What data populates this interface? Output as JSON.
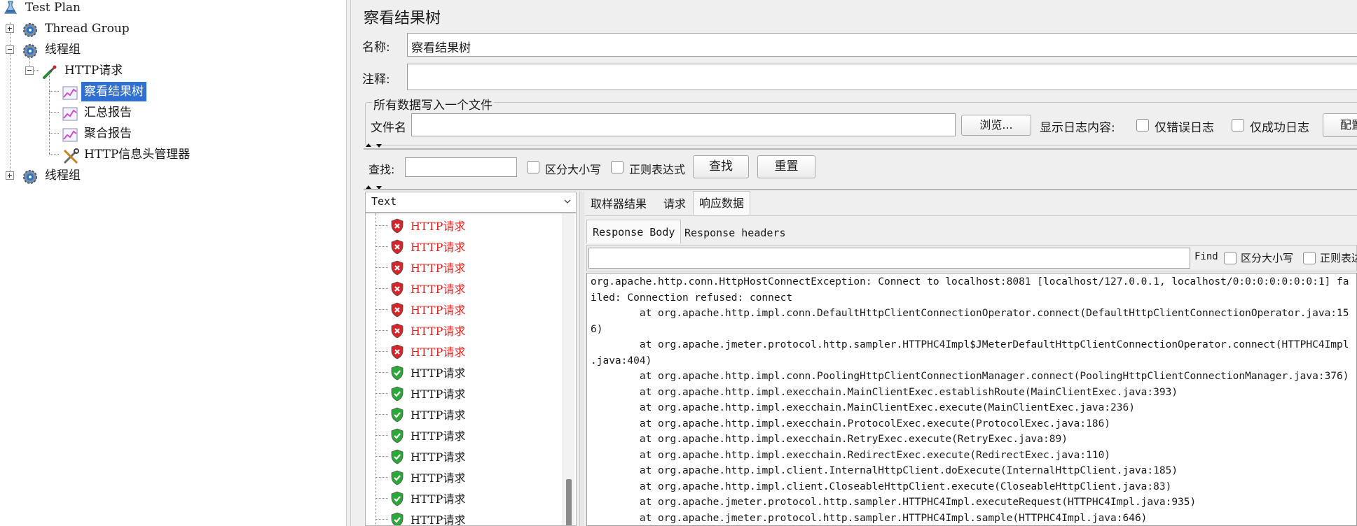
{
  "tree": {
    "items": [
      {
        "label": "Test Plan"
      },
      {
        "label": "Thread Group"
      },
      {
        "label": "线程组"
      },
      {
        "label": "HTTP请求"
      },
      {
        "label": "察看结果树"
      },
      {
        "label": "汇总报告"
      },
      {
        "label": "聚合报告"
      },
      {
        "label": "HTTP信息头管理器"
      },
      {
        "label": "线程组"
      }
    ]
  },
  "panel": {
    "title": "察看结果树",
    "name_label": "名称:",
    "name_value": "察看结果树",
    "comment_label": "注释:",
    "comment_value": "",
    "file_group_title": "所有数据写入一个文件",
    "filename_label": "文件名",
    "filename_value": "",
    "browse_button": "浏览...",
    "log_display_label": "显示日志内容:",
    "errors_only_label": "仅错误日志",
    "success_only_label": "仅成功日志",
    "config_button": "配置"
  },
  "search": {
    "label": "查找:",
    "value": "",
    "case_sensitive_label": "区分大小写",
    "regex_label": "正则表达式",
    "find_button": "查找",
    "reset_button": "重置"
  },
  "results": {
    "renderer": "Text",
    "items": [
      {
        "label": "HTTP请求",
        "status": "error"
      },
      {
        "label": "HTTP请求",
        "status": "error"
      },
      {
        "label": "HTTP请求",
        "status": "error"
      },
      {
        "label": "HTTP请求",
        "status": "error"
      },
      {
        "label": "HTTP请求",
        "status": "error"
      },
      {
        "label": "HTTP请求",
        "status": "error"
      },
      {
        "label": "HTTP请求",
        "status": "error"
      },
      {
        "label": "HTTP请求",
        "status": "success"
      },
      {
        "label": "HTTP请求",
        "status": "success"
      },
      {
        "label": "HTTP请求",
        "status": "success"
      },
      {
        "label": "HTTP请求",
        "status": "success"
      },
      {
        "label": "HTTP请求",
        "status": "success"
      },
      {
        "label": "HTTP请求",
        "status": "success"
      },
      {
        "label": "HTTP请求",
        "status": "success"
      },
      {
        "label": "HTTP请求",
        "status": "success"
      }
    ]
  },
  "tabs": {
    "main": [
      "取样器结果",
      "请求",
      "响应数据"
    ],
    "sub": [
      "Response Body",
      "Response headers"
    ]
  },
  "response": {
    "find_label": "Find",
    "find_value": "",
    "case_sensitive_label": "区分大小写",
    "regex_label": "正则表达",
    "lines": [
      "org.apache.http.conn.HttpHostConnectException: Connect to localhost:8081 [localhost/127.0.0.1, localhost/0:0:0:0:0:0:0:1] fa",
      "iled: Connection refused: connect",
      "\tat org.apache.http.impl.conn.DefaultHttpClientConnectionOperator.connect(DefaultHttpClientConnectionOperator.java:15",
      "6)",
      "\tat org.apache.jmeter.protocol.http.sampler.HTTPHC4Impl$JMeterDefaultHttpClientConnectionOperator.connect(HTTPHC4Impl",
      ".java:404)",
      "\tat org.apache.http.impl.conn.PoolingHttpClientConnectionManager.connect(PoolingHttpClientConnectionManager.java:376)",
      "\tat org.apache.http.impl.execchain.MainClientExec.establishRoute(MainClientExec.java:393)",
      "\tat org.apache.http.impl.execchain.MainClientExec.execute(MainClientExec.java:236)",
      "\tat org.apache.http.impl.execchain.ProtocolExec.execute(ProtocolExec.java:186)",
      "\tat org.apache.http.impl.execchain.RetryExec.execute(RetryExec.java:89)",
      "\tat org.apache.http.impl.execchain.RedirectExec.execute(RedirectExec.java:110)",
      "\tat org.apache.http.impl.client.InternalHttpClient.doExecute(InternalHttpClient.java:185)",
      "\tat org.apache.http.impl.client.CloseableHttpClient.execute(CloseableHttpClient.java:83)",
      "\tat org.apache.jmeter.protocol.http.sampler.HTTPHC4Impl.executeRequest(HTTPHC4Impl.java:935)",
      "\tat org.apache.jmeter.protocol.http.sampler.HTTPHC4Impl.sample(HTTPHC4Impl.java:646)"
    ]
  },
  "colors": {
    "selection": "#2f6fd1",
    "error_text": "#e8231f",
    "error_icon": "#d4262a",
    "success_icon": "#2aa838"
  }
}
